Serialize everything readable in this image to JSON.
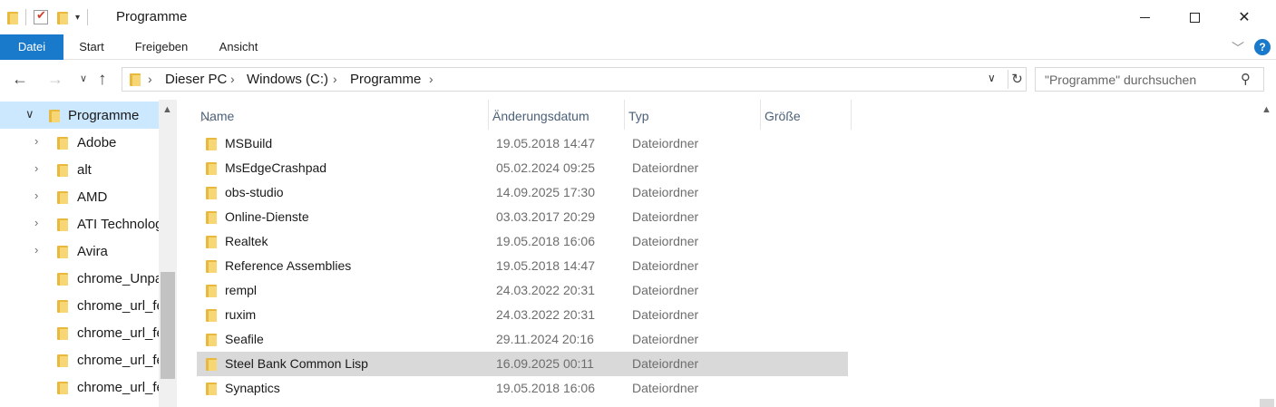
{
  "window": {
    "title": "Programme",
    "icons": [
      "folder-icon",
      "properties-icon",
      "new-folder-icon",
      "customize-dropdown-icon"
    ],
    "controls": [
      "minimize",
      "maximize",
      "close"
    ]
  },
  "ribbon": {
    "tabs": [
      "Datei",
      "Start",
      "Freigeben",
      "Ansicht"
    ],
    "active_tab": "Datei",
    "accent": "#1979ca",
    "help_label": "?"
  },
  "nav": {
    "breadcrumb": [
      "Dieser PC",
      "Windows (C:)",
      "Programme"
    ],
    "search_placeholder": "\"Programme\" durchsuchen"
  },
  "tree": {
    "selected": "Programme",
    "items": [
      {
        "label": "Programme",
        "expand": "expanded"
      },
      {
        "label": "Adobe",
        "expand": "collapsed"
      },
      {
        "label": "alt",
        "expand": "collapsed"
      },
      {
        "label": "AMD",
        "expand": "collapsed"
      },
      {
        "label": "ATI Technolog",
        "expand": "collapsed"
      },
      {
        "label": "Avira",
        "expand": "collapsed"
      },
      {
        "label": "chrome_Unpa",
        "expand": "none"
      },
      {
        "label": "chrome_url_fe",
        "expand": "none"
      },
      {
        "label": "chrome_url_fe",
        "expand": "none"
      },
      {
        "label": "chrome_url_fe",
        "expand": "none"
      },
      {
        "label": "chrome_url_fe",
        "expand": "none"
      }
    ]
  },
  "columns": {
    "name": "Name",
    "date": "Änderungsdatum",
    "type": "Typ",
    "size": "Größe"
  },
  "files": [
    {
      "name": "MSBuild",
      "date": "19.05.2018 14:47",
      "type": "Dateiordner"
    },
    {
      "name": "MsEdgeCrashpad",
      "date": "05.02.2024 09:25",
      "type": "Dateiordner"
    },
    {
      "name": "obs-studio",
      "date": "14.09.2025 17:30",
      "type": "Dateiordner"
    },
    {
      "name": "Online-Dienste",
      "date": "03.03.2017 20:29",
      "type": "Dateiordner"
    },
    {
      "name": "Realtek",
      "date": "19.05.2018 16:06",
      "type": "Dateiordner"
    },
    {
      "name": "Reference Assemblies",
      "date": "19.05.2018 14:47",
      "type": "Dateiordner"
    },
    {
      "name": "rempl",
      "date": "24.03.2022 20:31",
      "type": "Dateiordner"
    },
    {
      "name": "ruxim",
      "date": "24.03.2022 20:31",
      "type": "Dateiordner"
    },
    {
      "name": "Seafile",
      "date": "29.11.2024 20:16",
      "type": "Dateiordner"
    },
    {
      "name": "Steel Bank Common Lisp",
      "date": "16.09.2025 00:11",
      "type": "Dateiordner",
      "highlighted": true
    },
    {
      "name": "Synaptics",
      "date": "19.05.2018 16:06",
      "type": "Dateiordner"
    }
  ]
}
